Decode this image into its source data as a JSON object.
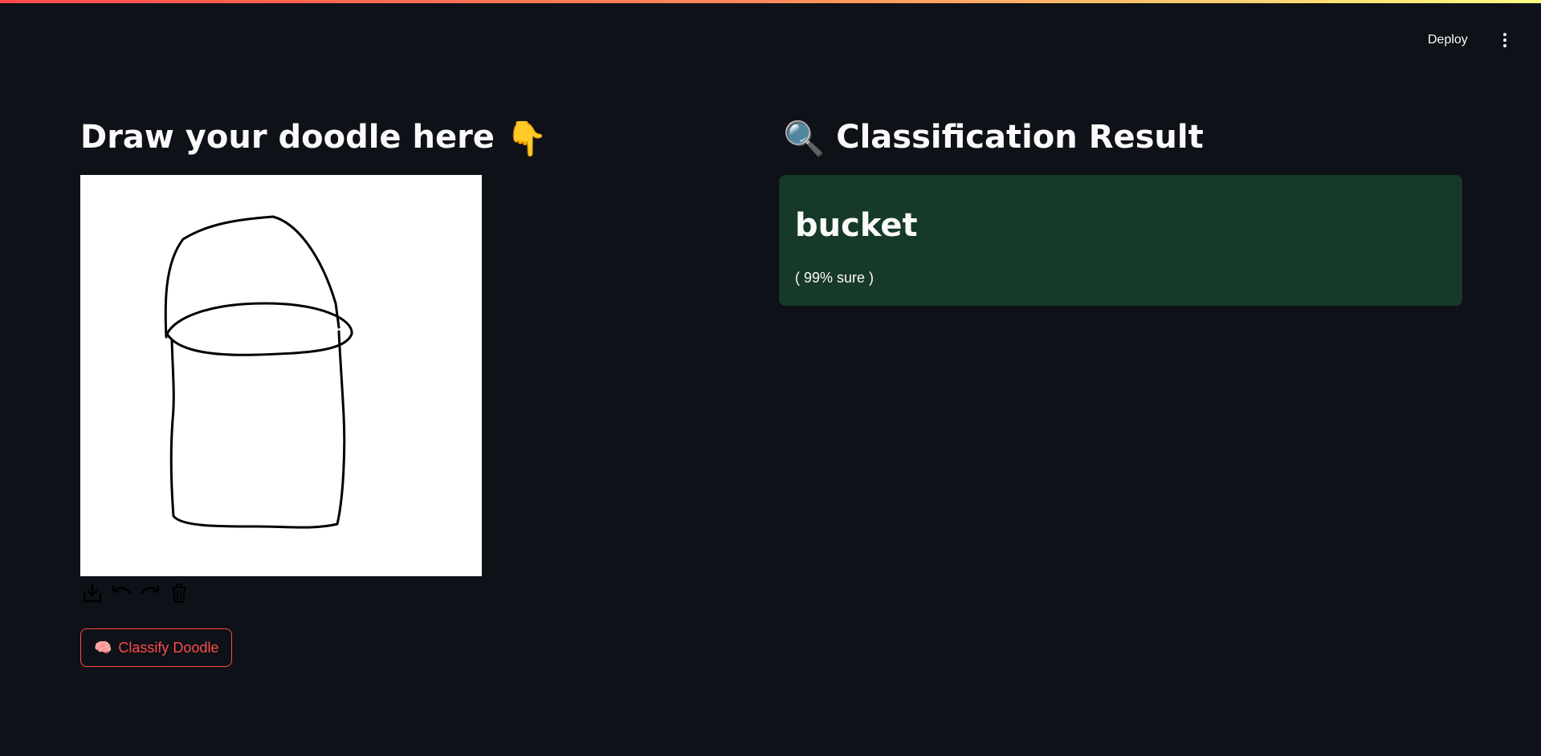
{
  "header": {
    "deploy_label": "Deploy",
    "menu_icon": "kebab-menu-icon"
  },
  "left": {
    "title": "Draw your doodle here",
    "title_emoji": "👇",
    "canvas_tools": [
      "download-icon",
      "undo-icon",
      "redo-icon",
      "trash-icon"
    ],
    "classify_button": {
      "emoji": "🧠",
      "label": "Classify Doodle"
    }
  },
  "right": {
    "title_emoji": "🔍",
    "title": "Classification Result",
    "result": {
      "label": "bucket",
      "confidence_text": "( 99% sure )"
    }
  },
  "colors": {
    "background": "#0e1117",
    "accent": "#ff4b4b",
    "success_bg": "#173928"
  }
}
